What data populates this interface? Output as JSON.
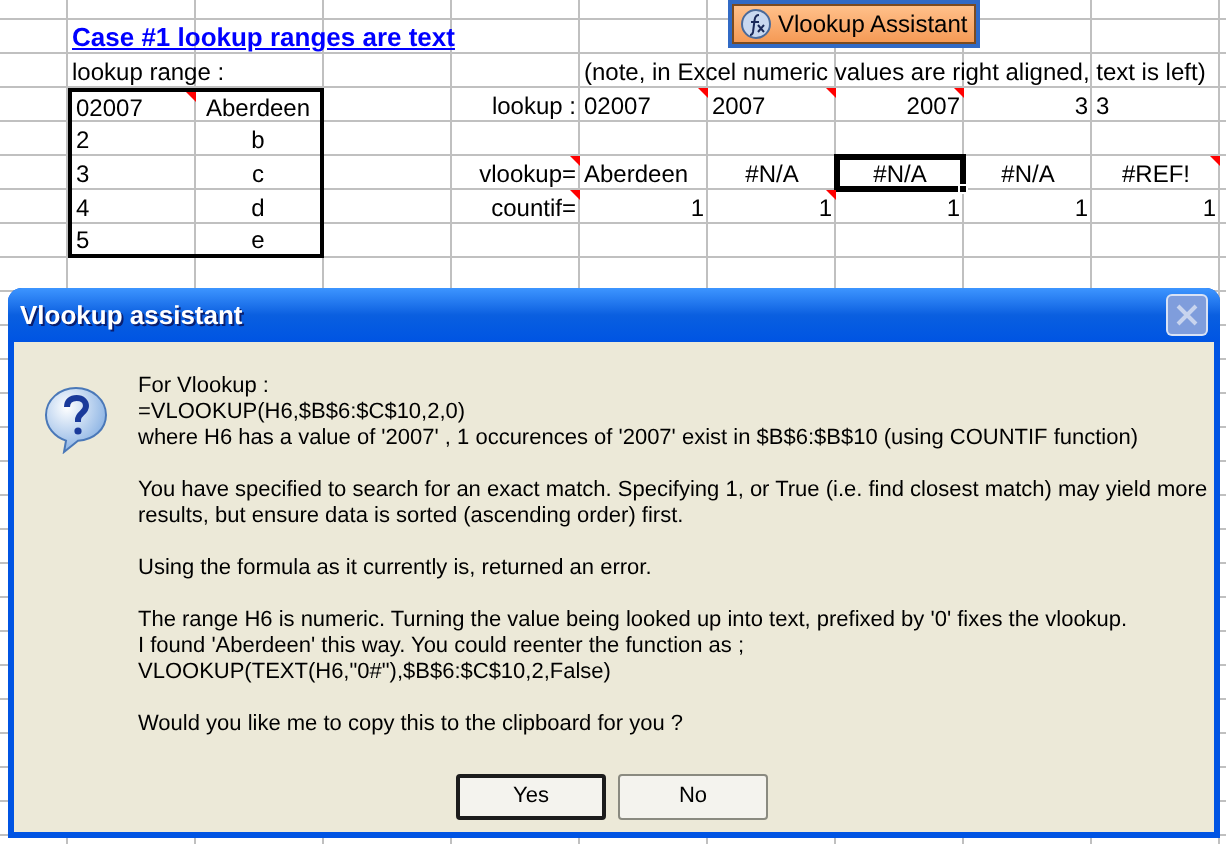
{
  "sheet": {
    "rows": [
      {
        "cells": [
          null,
          {
            "text": "Case #1 lookup ranges are text",
            "kind": "link",
            "comment": false,
            "selected": false,
            "boxed": false
          },
          null,
          null,
          null,
          null,
          null,
          null,
          null,
          null
        ]
      },
      {
        "cells": [
          null,
          {
            "text": "lookup range :",
            "kind": "text",
            "comment": false,
            "selected": false,
            "boxed": false
          },
          null,
          null,
          null,
          {
            "text": "(note, in Excel numeric values are right aligned, text is left)",
            "kind": "text",
            "comment": false,
            "selected": false,
            "boxed": false
          },
          null,
          null,
          null,
          null
        ]
      },
      {
        "cells": [
          null,
          {
            "text": "02007",
            "kind": "text",
            "comment": true,
            "selected": false,
            "boxed": true
          },
          {
            "text": "Aberdeen",
            "kind": "value",
            "comment": false,
            "selected": false,
            "boxed": true
          },
          null,
          {
            "text": "lookup :",
            "kind": "label",
            "comment": false,
            "selected": false,
            "boxed": false
          },
          {
            "text": "02007",
            "kind": "text",
            "comment": true,
            "selected": false,
            "boxed": false
          },
          {
            "text": "2007",
            "kind": "text",
            "comment": true,
            "selected": false,
            "boxed": false
          },
          {
            "text": "2007",
            "kind": "number",
            "comment": true,
            "selected": false,
            "boxed": false
          },
          {
            "text": "3",
            "kind": "number",
            "comment": false,
            "selected": false,
            "boxed": false
          },
          {
            "text": "3",
            "kind": "text",
            "comment": false,
            "selected": false,
            "boxed": false
          }
        ]
      },
      {
        "cells": [
          null,
          {
            "text": "2",
            "kind": "text",
            "comment": false,
            "selected": false,
            "boxed": true
          },
          {
            "text": "b",
            "kind": "value",
            "comment": false,
            "selected": false,
            "boxed": true
          },
          null,
          null,
          null,
          null,
          null,
          null,
          null
        ]
      },
      {
        "cells": [
          null,
          {
            "text": "3",
            "kind": "text",
            "comment": false,
            "selected": false,
            "boxed": true
          },
          {
            "text": "c",
            "kind": "value",
            "comment": false,
            "selected": false,
            "boxed": true
          },
          null,
          {
            "text": "vlookup=",
            "kind": "label",
            "comment": true,
            "selected": false,
            "boxed": false
          },
          {
            "text": "Aberdeen",
            "kind": "text",
            "comment": false,
            "selected": false,
            "boxed": false
          },
          {
            "text": "#N/A",
            "kind": "error",
            "comment": false,
            "selected": false,
            "boxed": false
          },
          {
            "text": "#N/A",
            "kind": "error",
            "comment": false,
            "selected": true,
            "boxed": false
          },
          {
            "text": "#N/A",
            "kind": "error",
            "comment": false,
            "selected": false,
            "boxed": false
          },
          {
            "text": "#REF!",
            "kind": "error",
            "comment": true,
            "selected": false,
            "boxed": false
          }
        ]
      },
      {
        "cells": [
          null,
          {
            "text": "4",
            "kind": "text",
            "comment": false,
            "selected": false,
            "boxed": true
          },
          {
            "text": "d",
            "kind": "value",
            "comment": false,
            "selected": false,
            "boxed": true
          },
          null,
          {
            "text": "countif=",
            "kind": "label",
            "comment": true,
            "selected": false,
            "boxed": false
          },
          {
            "text": "1",
            "kind": "number",
            "comment": false,
            "selected": false,
            "boxed": false
          },
          {
            "text": "1",
            "kind": "number",
            "comment": true,
            "selected": false,
            "boxed": false
          },
          {
            "text": "1",
            "kind": "number",
            "comment": false,
            "selected": false,
            "boxed": false
          },
          {
            "text": "1",
            "kind": "number",
            "comment": false,
            "selected": false,
            "boxed": false
          },
          {
            "text": "1",
            "kind": "number",
            "comment": false,
            "selected": false,
            "boxed": false
          }
        ]
      },
      {
        "cells": [
          null,
          {
            "text": "5",
            "kind": "text",
            "comment": false,
            "selected": false,
            "boxed": true
          },
          {
            "text": "e",
            "kind": "value",
            "comment": false,
            "selected": false,
            "boxed": true
          },
          null,
          null,
          null,
          null,
          null,
          null,
          null
        ]
      }
    ]
  },
  "macro_button": {
    "label": "Vlookup Assistant"
  },
  "dialog": {
    "title": "Vlookup assistant",
    "paragraphs": [
      {
        "lines": [
          "For Vlookup :",
          "=VLOOKUP(H6,$B$6:$C$10,2,0)",
          "where H6 has a value of '2007' , 1 occurences of '2007' exist in $B$6:$B$10 (using COUNTIF function)"
        ]
      },
      {
        "lines": [
          "You have specified to search for an exact match. Specifying 1, or True (i.e. find closest match) may yield more",
          "results, but ensure data is sorted (ascending order) first."
        ]
      },
      {
        "lines": [
          "Using the formula as it currently is, returned an error."
        ]
      },
      {
        "lines": [
          "The range H6 is numeric. Turning the value being looked up into text, prefixed by '0' fixes the vlookup.",
          "I found 'Aberdeen' this way. You could reenter the function as ;",
          "VLOOKUP(TEXT(H6,\"0#\"),$B$6:$C$10,2,False)"
        ]
      },
      {
        "lines": [
          "Would you like me to copy this to the clipboard for you ?"
        ]
      }
    ],
    "buttons": [
      {
        "label": "Yes",
        "default": true
      },
      {
        "label": "No",
        "default": false
      }
    ]
  }
}
